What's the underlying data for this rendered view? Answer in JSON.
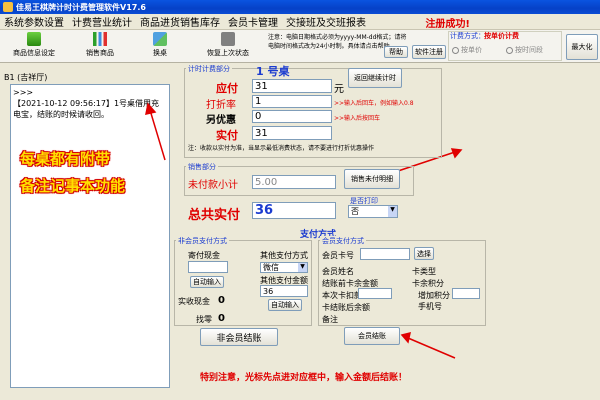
{
  "window": {
    "title": "佳易王棋牌计时计费管理软件V17.6"
  },
  "menu": [
    "系统参数设置",
    "计费营业统计",
    "商品进货销售库存",
    "会员卡管理",
    "交接班及交班报表"
  ],
  "status_message": "注册成功!",
  "toolbar": [
    {
      "label": "商品信息设定",
      "icon": "green-box-icon"
    },
    {
      "label": "销售商品",
      "icon": "bar-chart-icon"
    },
    {
      "label": "换桌",
      "icon": "swap-icon"
    },
    {
      "label": "恢复上次状态",
      "icon": "restore-icon"
    }
  ],
  "notice": {
    "text": "注意：电脑日期格式必须为yyyy-MM-dd格式；请将电脑时间格式改为24小时制。具体请点击帮助",
    "help_label": "帮助",
    "register_label": "软件注册"
  },
  "billing_mode": {
    "label": "计费方式：",
    "value": "按单价计费",
    "options": [
      "按单价",
      "按时间段"
    ]
  },
  "maximize_label": "最大化",
  "room": {
    "label": "B1  (吉祥厅)"
  },
  "log": {
    "prompt": ">>>",
    "entry": "【2021-10-12 09:56:17】1号桌借用充电宝，结账的时候请收回。"
  },
  "annotation": [
    "每桌都有附带",
    "备注记事本功能"
  ],
  "billing": {
    "group_title": "计时计费部分",
    "table_title": "1   号桌",
    "due_label": "应付",
    "due_value": "31",
    "unit": "元",
    "return_button": "返回继续计时",
    "discount_label": "打折率",
    "discount_value": "1",
    "discount_hint": ">>输入后回车，例如输入0.8",
    "extra_label": "另优惠",
    "extra_value": "0",
    "extra_hint": ">>输入后按回车",
    "paid_label": "实付",
    "paid_value": "31",
    "note": "注：收款以实付为准，当显示最低消费状态，请不要进行打折优惠操作"
  },
  "sales": {
    "group_title": "销售部分",
    "unpaid_label": "未付款小计",
    "unpaid_value": "5.00",
    "detail_button": "销售未付明细"
  },
  "total": {
    "label": "总共实付",
    "value": "36",
    "print_label": "是否打印",
    "print_value": "否"
  },
  "payment": {
    "title": "支付方式",
    "non_member_title": "非会员支付方式",
    "cash_label": "寄付现金",
    "cash_value": "",
    "auto_input_label": "自动输入",
    "other_method_label": "其他支付方式",
    "other_method_value": "微信",
    "other_amount_label": "其他支付金额",
    "other_amount_value": "36",
    "auto_input_label2": "自动输入",
    "actual_cash_label": "实收现金",
    "actual_cash_value": "0",
    "change_label": "找零",
    "change_value": "0",
    "non_member_checkout": "非会员结账",
    "member_title": "会员支付方式",
    "card_no_label": "会员卡号",
    "select_label": "选择",
    "member_name_label": "会员姓名",
    "card_type_label": "卡类型",
    "balance_before_label": "结账前卡余金额",
    "card_points_label": "卡余积分",
    "deduct_label": "本次卡扣款",
    "add_points_label": "增加积分",
    "balance_after_label": "卡结账后余额",
    "phone_label": "手机号",
    "remark_label": "备注",
    "member_checkout": "会员结账"
  },
  "bottom_warning": "特别注意，光标先点进对应框中，输入金额后结账！",
  "colors": {
    "title_bar": "#0a54e0",
    "accent_red": "#e00000",
    "label_blue": "#1a3bd0"
  }
}
